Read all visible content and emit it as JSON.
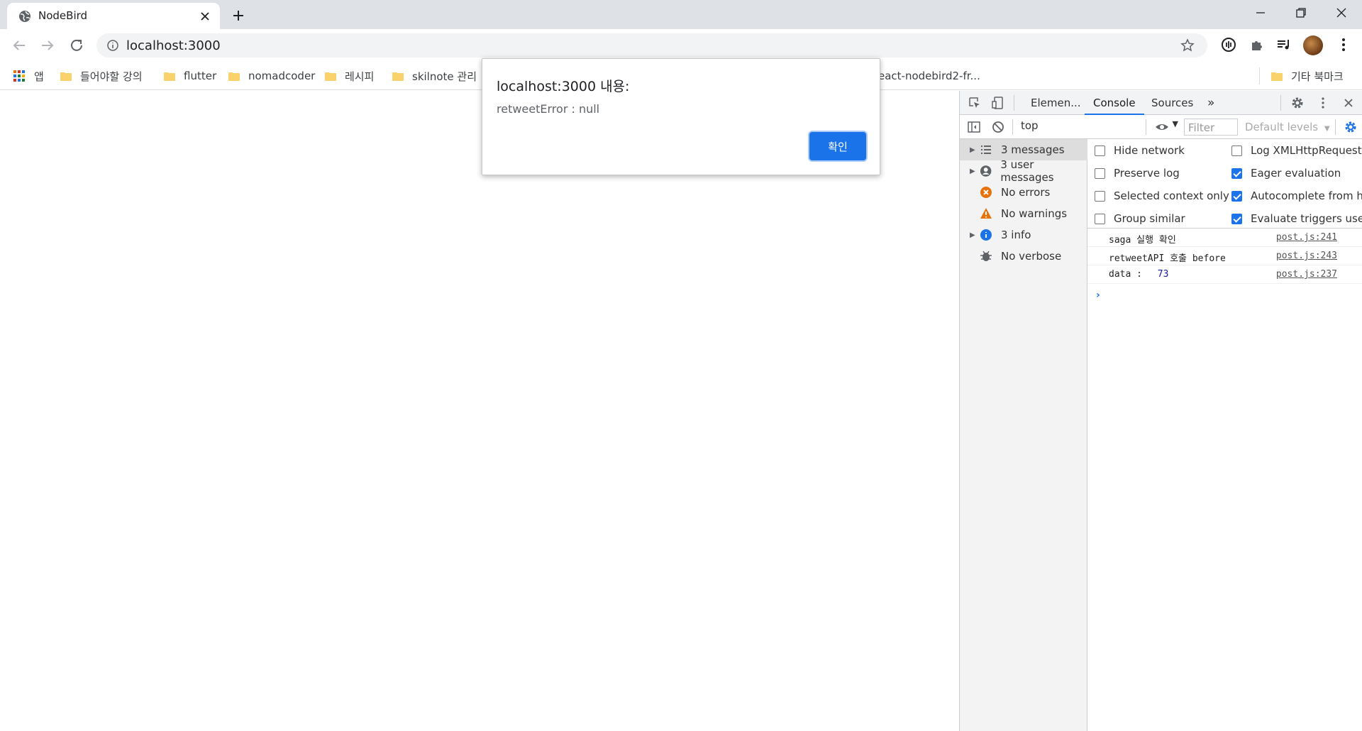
{
  "browser": {
    "tab_title": "NodeBird",
    "url": "localhost:3000"
  },
  "bookmarks": [
    {
      "label": "앱",
      "kind": "apps"
    },
    {
      "label": "들어야할 강의",
      "kind": "folder"
    },
    {
      "label": "flutter",
      "kind": "folder"
    },
    {
      "label": "nomadcoder",
      "kind": "folder"
    },
    {
      "label": "레시피",
      "kind": "folder"
    },
    {
      "label": "skilnote 관리",
      "kind": "folder"
    },
    {
      "label": "eact-nodebird2-fr...",
      "kind": "partial"
    },
    {
      "label": "기타 북마크",
      "kind": "folder"
    }
  ],
  "dialog": {
    "title": "localhost:3000 내용:",
    "message": "retweetError : null",
    "ok_label": "확인"
  },
  "devtools": {
    "tabs": [
      "Elemen...",
      "Console",
      "Sources"
    ],
    "context": "top",
    "filter_placeholder": "Filter",
    "levels_label": "Default levels",
    "sidebar": [
      {
        "label": "3 messages",
        "icon": "list-icon",
        "expandable": true,
        "selected": true
      },
      {
        "label": "3 user messages",
        "icon": "user-icon",
        "expandable": true,
        "selected": false
      },
      {
        "label": "No errors",
        "icon": "error-icon",
        "expandable": false,
        "selected": false
      },
      {
        "label": "No warnings",
        "icon": "warning-icon",
        "expandable": false,
        "selected": false
      },
      {
        "label": "3 info",
        "icon": "info-icon",
        "expandable": true,
        "selected": false
      },
      {
        "label": "No verbose",
        "icon": "bug-icon",
        "expandable": false,
        "selected": false
      }
    ],
    "settings_left": [
      {
        "label": "Hide network",
        "checked": false
      },
      {
        "label": "Preserve log",
        "checked": false
      },
      {
        "label": "Selected context only",
        "checked": false
      },
      {
        "label": "Group similar",
        "checked": false
      }
    ],
    "settings_right": [
      {
        "label": "Log XMLHttpRequests",
        "checked": false
      },
      {
        "label": "Eager evaluation",
        "checked": true
      },
      {
        "label": "Autocomplete from hist",
        "checked": true
      },
      {
        "label": "Evaluate triggers user ac",
        "checked": true
      }
    ],
    "logs": [
      {
        "text": "saga 실행 확인",
        "num": "",
        "source": "post.js:241"
      },
      {
        "text": "retweetAPI 호출 before",
        "num": "",
        "source": "post.js:243"
      },
      {
        "text": "data :",
        "num": "73",
        "source": "post.js:237"
      }
    ],
    "prompt": "›"
  }
}
